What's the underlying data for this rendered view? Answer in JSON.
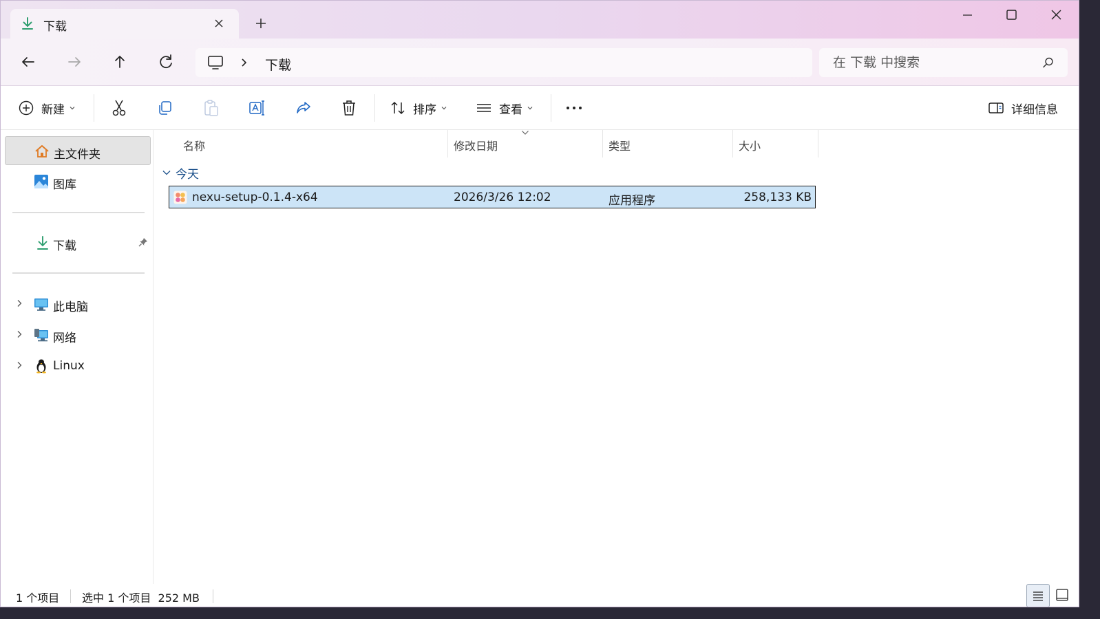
{
  "tab": {
    "title": "下载",
    "icon": "download-arrow-icon"
  },
  "window_controls": {
    "minimize": "minimize-icon",
    "maximize": "maximize-icon",
    "close": "close-icon"
  },
  "address": {
    "root_icon": "this-pc-icon",
    "crumbs": [
      "下载"
    ]
  },
  "search": {
    "placeholder": "在 下载 中搜索"
  },
  "toolbar": {
    "new_label": "新建",
    "sort_label": "排序",
    "view_label": "查看",
    "details_label": "详细信息"
  },
  "sidebar": {
    "home": "主文件夹",
    "gallery": "图库",
    "downloads": "下载",
    "this_pc": "此电脑",
    "network": "网络",
    "linux": "Linux"
  },
  "columns": {
    "name": "名称",
    "modified": "修改日期",
    "type": "类型",
    "size": "大小"
  },
  "group": {
    "label": "今天"
  },
  "files": [
    {
      "name": "nexu-setup-0.1.4-x64",
      "modified": "2026/3/26 12:02",
      "type": "应用程序",
      "size": "258,133 KB",
      "selected": true
    }
  ],
  "status": {
    "count": "1 个项目",
    "selection": "选中 1 个项目  252 MB"
  },
  "colors": {
    "accent_download": "#2e9e6f",
    "selection_bg": "#cce4f7",
    "group_text": "#1a4f8a"
  }
}
